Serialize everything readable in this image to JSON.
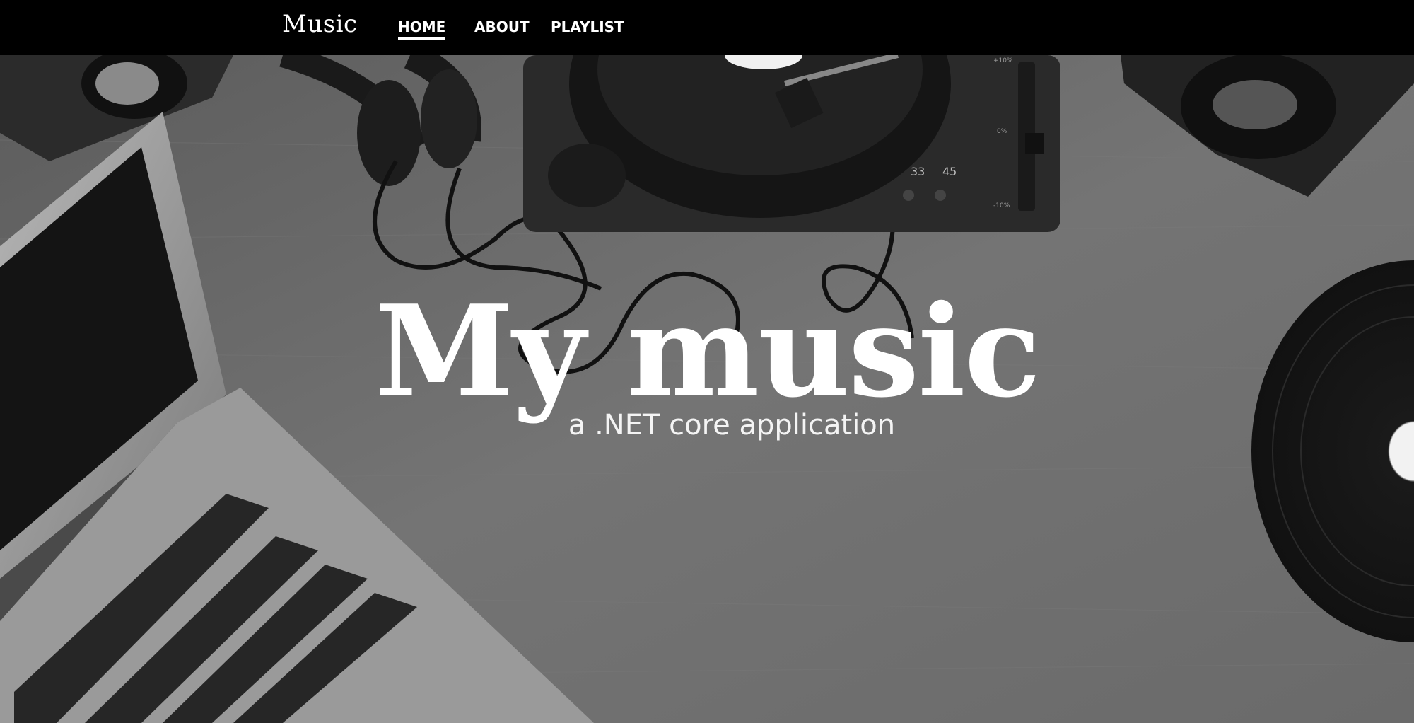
{
  "nav": {
    "brand": "Music",
    "links": [
      {
        "label": "HOME",
        "active": true
      },
      {
        "label": "ABOUT",
        "active": false
      },
      {
        "label": "PLAYLIST",
        "active": false
      }
    ]
  },
  "hero": {
    "title": "My music",
    "subtitle": "a .NET core application"
  },
  "turntable": {
    "speed_33": "33",
    "speed_45": "45",
    "pitch_plus": "+10%",
    "pitch_zero": "0%",
    "pitch_minus": "-10%"
  },
  "colors": {
    "navbar": "#000000",
    "background": "#6f6f6f",
    "text": "#ffffff"
  }
}
